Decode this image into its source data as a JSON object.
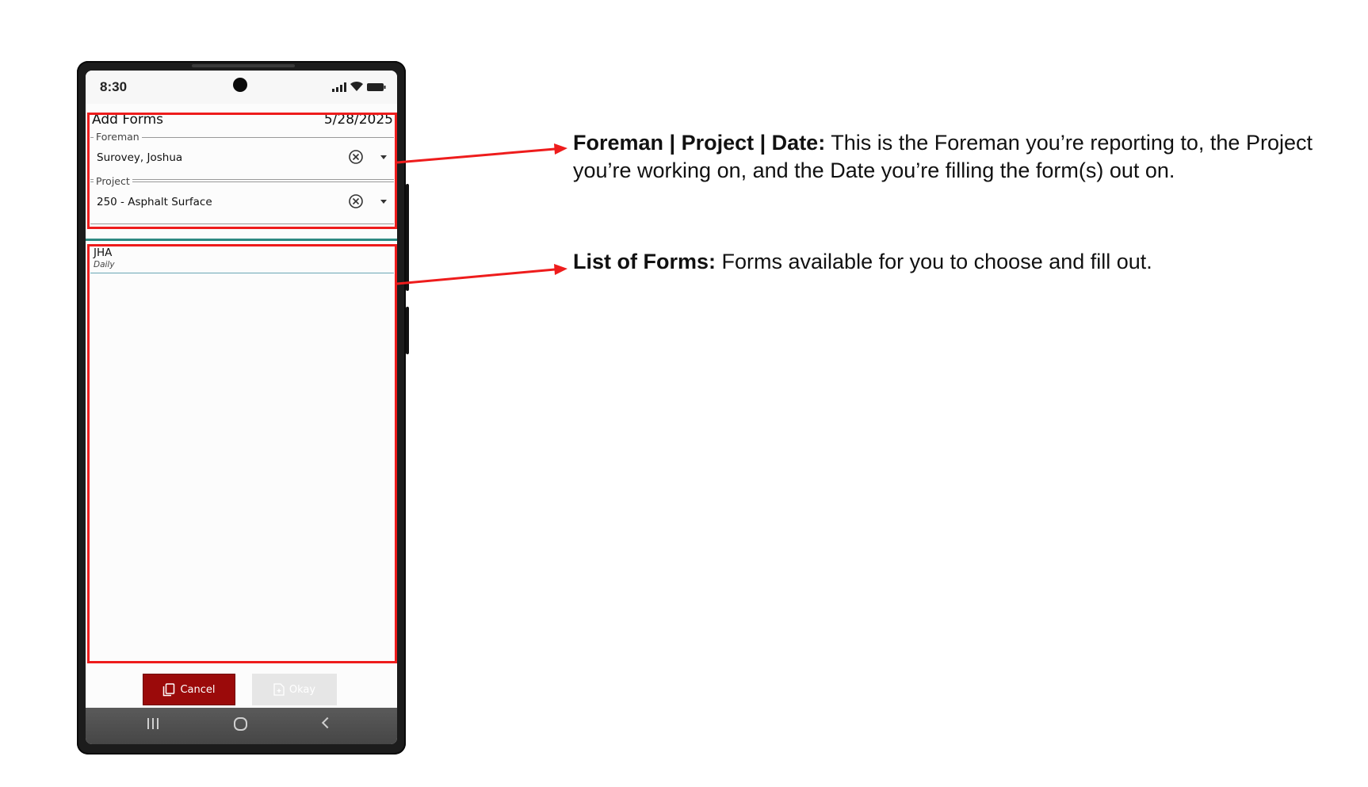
{
  "status_bar": {
    "time": "8:30"
  },
  "header": {
    "title": "Add Forms",
    "date": "5/28/2025"
  },
  "foreman": {
    "label": "Foreman",
    "value": "Surovey, Joshua"
  },
  "project": {
    "label": "Project",
    "value": "250 - Asphalt Surface"
  },
  "forms_list": [
    {
      "title": "JHA",
      "frequency": "Daily"
    }
  ],
  "buttons": {
    "cancel_label": "Cancel",
    "okay_label": "Okay"
  },
  "colors": {
    "annotation_red": "#ee1c1c",
    "cancel_button": "#9b0a0a",
    "divider_teal": "#2e8a82"
  },
  "icons": {
    "clear": "circle-x-icon",
    "dropdown": "caret-down-icon",
    "cancel": "copy-icon",
    "okay": "document-add-icon"
  },
  "annotations": [
    {
      "heading": "Foreman | Project | Date:",
      "body": "This is the Foreman you’re reporting to, the Project you’re working on, and the Date you’re filling the form(s) out on."
    },
    {
      "heading": "List of Forms:",
      "body": "Forms available for you to choose and fill out."
    }
  ]
}
